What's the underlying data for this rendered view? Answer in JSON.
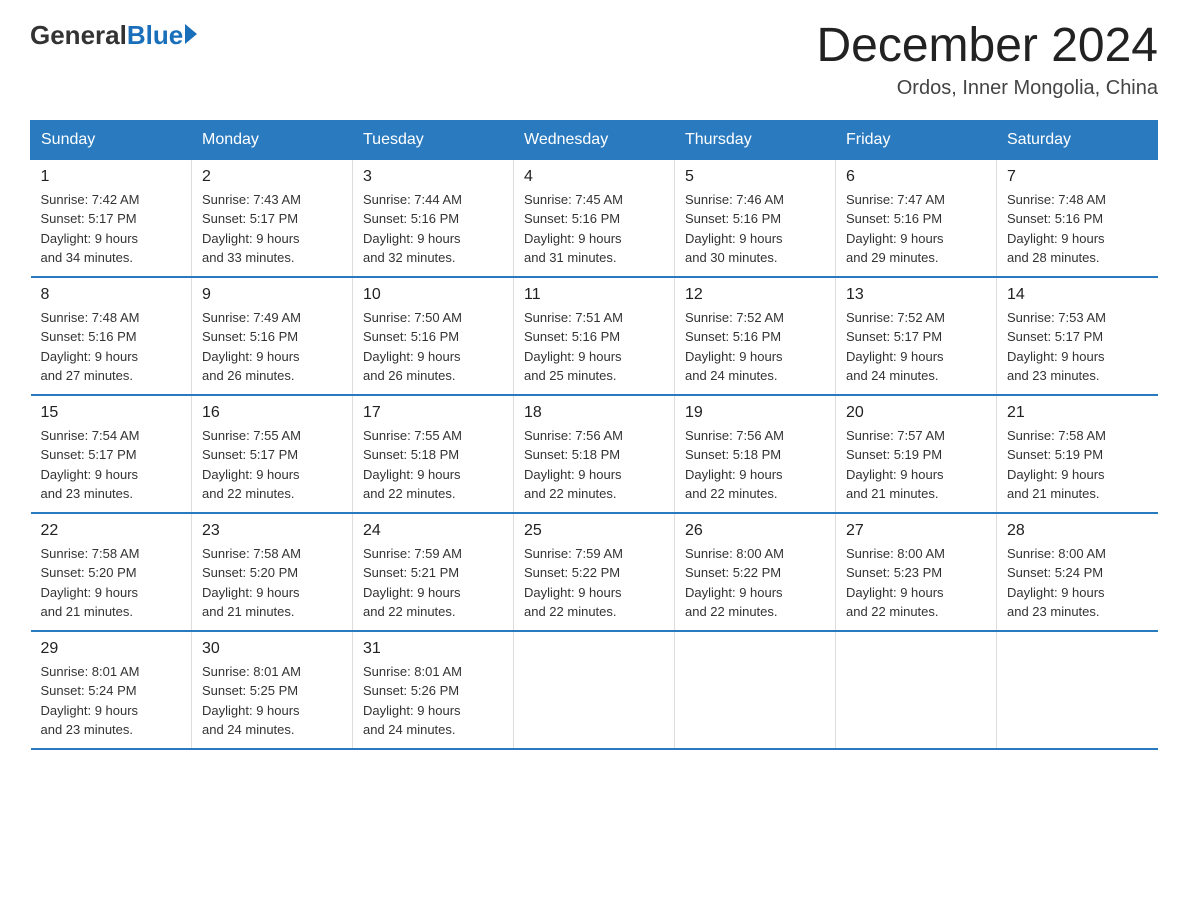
{
  "logo": {
    "general": "General",
    "blue": "Blue"
  },
  "title": "December 2024",
  "subtitle": "Ordos, Inner Mongolia, China",
  "days_of_week": [
    "Sunday",
    "Monday",
    "Tuesday",
    "Wednesday",
    "Thursday",
    "Friday",
    "Saturday"
  ],
  "weeks": [
    [
      {
        "num": "1",
        "sunrise": "7:42 AM",
        "sunset": "5:17 PM",
        "daylight": "9 hours and 34 minutes."
      },
      {
        "num": "2",
        "sunrise": "7:43 AM",
        "sunset": "5:17 PM",
        "daylight": "9 hours and 33 minutes."
      },
      {
        "num": "3",
        "sunrise": "7:44 AM",
        "sunset": "5:16 PM",
        "daylight": "9 hours and 32 minutes."
      },
      {
        "num": "4",
        "sunrise": "7:45 AM",
        "sunset": "5:16 PM",
        "daylight": "9 hours and 31 minutes."
      },
      {
        "num": "5",
        "sunrise": "7:46 AM",
        "sunset": "5:16 PM",
        "daylight": "9 hours and 30 minutes."
      },
      {
        "num": "6",
        "sunrise": "7:47 AM",
        "sunset": "5:16 PM",
        "daylight": "9 hours and 29 minutes."
      },
      {
        "num": "7",
        "sunrise": "7:48 AM",
        "sunset": "5:16 PM",
        "daylight": "9 hours and 28 minutes."
      }
    ],
    [
      {
        "num": "8",
        "sunrise": "7:48 AM",
        "sunset": "5:16 PM",
        "daylight": "9 hours and 27 minutes."
      },
      {
        "num": "9",
        "sunrise": "7:49 AM",
        "sunset": "5:16 PM",
        "daylight": "9 hours and 26 minutes."
      },
      {
        "num": "10",
        "sunrise": "7:50 AM",
        "sunset": "5:16 PM",
        "daylight": "9 hours and 26 minutes."
      },
      {
        "num": "11",
        "sunrise": "7:51 AM",
        "sunset": "5:16 PM",
        "daylight": "9 hours and 25 minutes."
      },
      {
        "num": "12",
        "sunrise": "7:52 AM",
        "sunset": "5:16 PM",
        "daylight": "9 hours and 24 minutes."
      },
      {
        "num": "13",
        "sunrise": "7:52 AM",
        "sunset": "5:17 PM",
        "daylight": "9 hours and 24 minutes."
      },
      {
        "num": "14",
        "sunrise": "7:53 AM",
        "sunset": "5:17 PM",
        "daylight": "9 hours and 23 minutes."
      }
    ],
    [
      {
        "num": "15",
        "sunrise": "7:54 AM",
        "sunset": "5:17 PM",
        "daylight": "9 hours and 23 minutes."
      },
      {
        "num": "16",
        "sunrise": "7:55 AM",
        "sunset": "5:17 PM",
        "daylight": "9 hours and 22 minutes."
      },
      {
        "num": "17",
        "sunrise": "7:55 AM",
        "sunset": "5:18 PM",
        "daylight": "9 hours and 22 minutes."
      },
      {
        "num": "18",
        "sunrise": "7:56 AM",
        "sunset": "5:18 PM",
        "daylight": "9 hours and 22 minutes."
      },
      {
        "num": "19",
        "sunrise": "7:56 AM",
        "sunset": "5:18 PM",
        "daylight": "9 hours and 22 minutes."
      },
      {
        "num": "20",
        "sunrise": "7:57 AM",
        "sunset": "5:19 PM",
        "daylight": "9 hours and 21 minutes."
      },
      {
        "num": "21",
        "sunrise": "7:58 AM",
        "sunset": "5:19 PM",
        "daylight": "9 hours and 21 minutes."
      }
    ],
    [
      {
        "num": "22",
        "sunrise": "7:58 AM",
        "sunset": "5:20 PM",
        "daylight": "9 hours and 21 minutes."
      },
      {
        "num": "23",
        "sunrise": "7:58 AM",
        "sunset": "5:20 PM",
        "daylight": "9 hours and 21 minutes."
      },
      {
        "num": "24",
        "sunrise": "7:59 AM",
        "sunset": "5:21 PM",
        "daylight": "9 hours and 22 minutes."
      },
      {
        "num": "25",
        "sunrise": "7:59 AM",
        "sunset": "5:22 PM",
        "daylight": "9 hours and 22 minutes."
      },
      {
        "num": "26",
        "sunrise": "8:00 AM",
        "sunset": "5:22 PM",
        "daylight": "9 hours and 22 minutes."
      },
      {
        "num": "27",
        "sunrise": "8:00 AM",
        "sunset": "5:23 PM",
        "daylight": "9 hours and 22 minutes."
      },
      {
        "num": "28",
        "sunrise": "8:00 AM",
        "sunset": "5:24 PM",
        "daylight": "9 hours and 23 minutes."
      }
    ],
    [
      {
        "num": "29",
        "sunrise": "8:01 AM",
        "sunset": "5:24 PM",
        "daylight": "9 hours and 23 minutes."
      },
      {
        "num": "30",
        "sunrise": "8:01 AM",
        "sunset": "5:25 PM",
        "daylight": "9 hours and 24 minutes."
      },
      {
        "num": "31",
        "sunrise": "8:01 AM",
        "sunset": "5:26 PM",
        "daylight": "9 hours and 24 minutes."
      },
      null,
      null,
      null,
      null
    ]
  ],
  "labels": {
    "sunrise": "Sunrise:",
    "sunset": "Sunset:",
    "daylight": "Daylight:"
  }
}
